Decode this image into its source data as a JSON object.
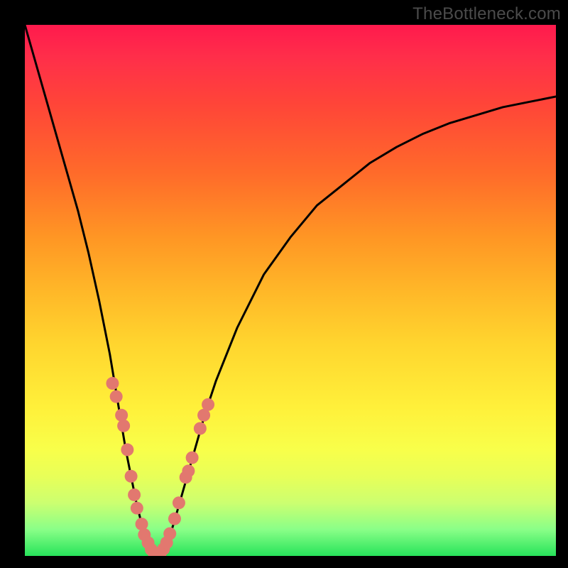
{
  "watermark": {
    "text": "TheBottleneck.com"
  },
  "colors": {
    "frame": "#000000",
    "curve": "#000000",
    "dot": "#e2786f",
    "gradient_stops": [
      "#ff1a4d",
      "#ff2e4a",
      "#ff4538",
      "#ff6b2a",
      "#ff9624",
      "#ffb728",
      "#ffd52e",
      "#fff03a",
      "#f8ff4a",
      "#e8ff58",
      "#ccff70",
      "#8aff88",
      "#27e35a"
    ]
  },
  "chart_data": {
    "type": "line",
    "title": "",
    "xlabel": "",
    "ylabel": "",
    "xlim": [
      0,
      100
    ],
    "ylim": [
      0,
      100
    ],
    "annotations": [
      "TheBottleneck.com"
    ],
    "description": "Bottleneck-style V curve on a red→green heat gradient. y≈0 is optimal (green), y≈100 is worst (red). Minimum near x≈25. Salmon dots mark sampled configurations clustered on the lower part of both arms.",
    "series": [
      {
        "name": "bottleneck-curve",
        "x": [
          0,
          2,
          4,
          6,
          8,
          10,
          12,
          14,
          16,
          18,
          19,
          20,
          21,
          22,
          23,
          24,
          25,
          26,
          27,
          28,
          30,
          32,
          34,
          36,
          40,
          45,
          50,
          55,
          60,
          65,
          70,
          75,
          80,
          85,
          90,
          95,
          100
        ],
        "y": [
          100,
          93,
          86,
          79,
          72,
          65,
          57,
          48,
          38,
          26,
          20,
          15,
          10,
          6,
          3,
          1,
          0.2,
          1,
          3,
          6,
          13,
          20,
          27,
          33,
          43,
          53,
          60,
          66,
          70,
          74,
          77,
          79.5,
          81.5,
          83,
          84.5,
          85.5,
          86.5
        ]
      },
      {
        "name": "sample-dots",
        "x": [
          16.5,
          17.2,
          18.2,
          18.6,
          19.3,
          20.0,
          20.6,
          21.1,
          22.0,
          22.5,
          23.2,
          23.8,
          24.3,
          24.9,
          25.5,
          26.1,
          26.7,
          27.3,
          28.2,
          29.0,
          30.3,
          30.8,
          31.5,
          33.0,
          33.7,
          34.5
        ],
        "y": [
          32.5,
          30.0,
          26.5,
          24.5,
          20.0,
          15.0,
          11.5,
          9.0,
          6.0,
          4.0,
          2.5,
          1.2,
          0.6,
          0.3,
          0.5,
          1.3,
          2.5,
          4.2,
          7.0,
          10.0,
          14.8,
          16.0,
          18.5,
          24.0,
          26.5,
          28.5
        ]
      }
    ]
  }
}
